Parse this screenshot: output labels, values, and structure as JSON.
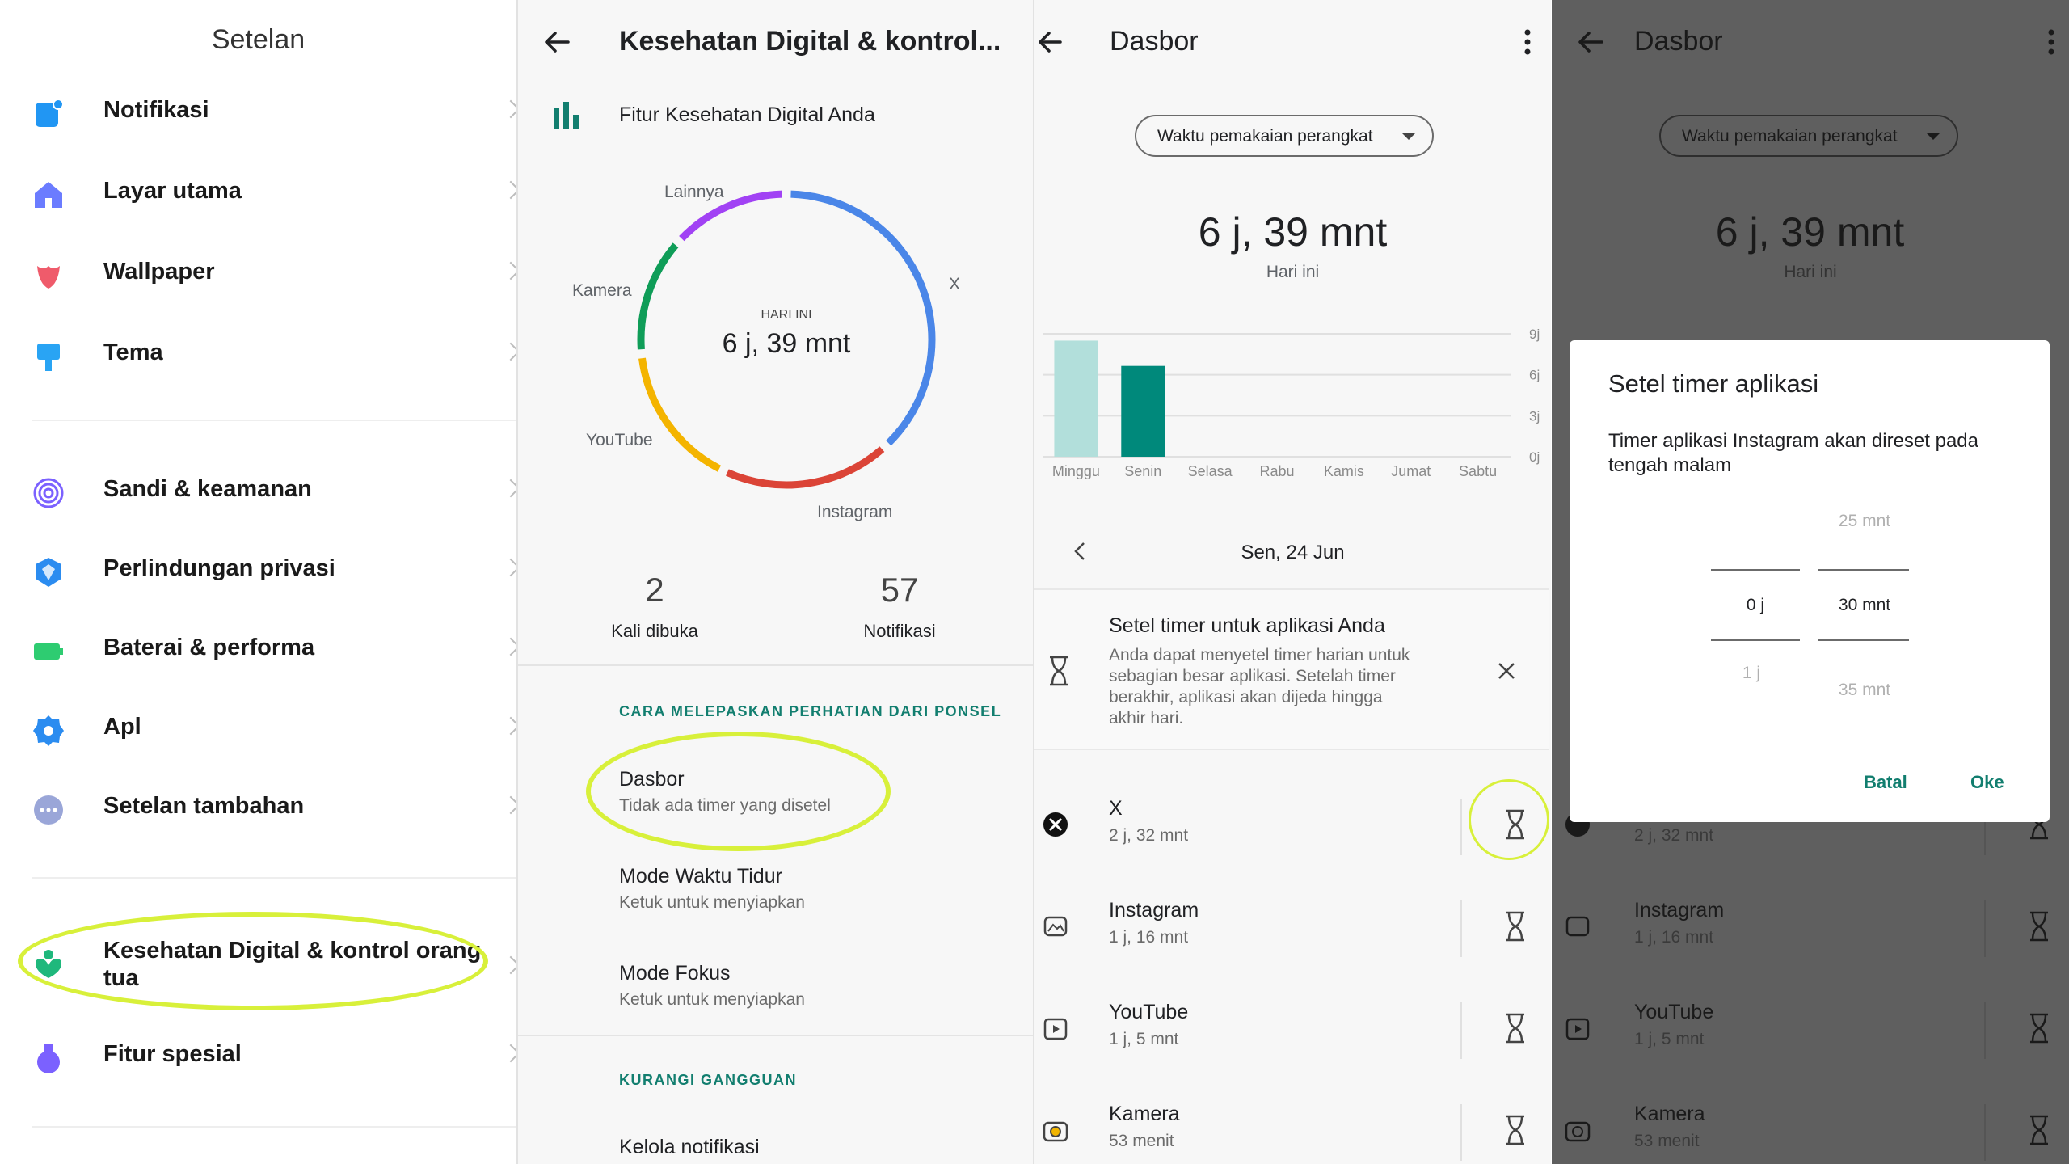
{
  "settings": {
    "title": "Setelan",
    "items": [
      {
        "label": "Notifikasi",
        "icon": "notification-icon",
        "color": "#2196f3"
      },
      {
        "label": "Layar utama",
        "icon": "home-icon",
        "color": "#6b7cff"
      },
      {
        "label": "Wallpaper",
        "icon": "tulip-icon",
        "color": "#ef5b6b"
      },
      {
        "label": "Tema",
        "icon": "brush-icon",
        "color": "#29a4f4"
      },
      {
        "label": "Sandi & keamanan",
        "icon": "fingerprint-icon",
        "color": "#7b61ff"
      },
      {
        "label": "Perlindungan privasi",
        "icon": "shield-icon",
        "color": "#2b8cf0"
      },
      {
        "label": "Baterai & performa",
        "icon": "battery-icon",
        "color": "#2ecc71"
      },
      {
        "label": "Apl",
        "icon": "gear-icon",
        "color": "#2b8cf0"
      },
      {
        "label": "Setelan tambahan",
        "icon": "more-icon",
        "color": "#9aa6d8"
      },
      {
        "label": "Kesehatan Digital & kontrol orang tua",
        "line1": "Kesehatan Digital & kontrol orang",
        "line2": "tua",
        "icon": "wellbeing-icon",
        "color": "#1fb87c"
      },
      {
        "label": "Fitur spesial",
        "icon": "flask-icon",
        "color": "#7b61ff"
      }
    ]
  },
  "wellbeing": {
    "title": "Kesehatan Digital & kontrol...",
    "feature_label": "Fitur Kesehatan Digital Anda",
    "donut": {
      "center_caption": "HARI INI",
      "center_value": "6 j, 39 mnt",
      "segments": [
        {
          "label": "X",
          "minutes": 152,
          "color": "#4a86e8"
        },
        {
          "label": "Instagram",
          "minutes": 76,
          "color": "#db4437"
        },
        {
          "label": "YouTube",
          "minutes": 65,
          "color": "#f4b400"
        },
        {
          "label": "Kamera",
          "minutes": 53,
          "color": "#0f9d58"
        },
        {
          "label": "Lainnya",
          "minutes": 53,
          "color": "#a142f4"
        }
      ]
    },
    "stats": [
      {
        "value": "2",
        "label": "Kali dibuka"
      },
      {
        "value": "57",
        "label": "Notifikasi"
      }
    ],
    "section1": "CARA MELEPASKAN PERHATIAN DARI PONSEL",
    "rows": [
      {
        "title": "Dasbor",
        "sub": "Tidak ada timer yang disetel"
      },
      {
        "title": "Mode Waktu Tidur",
        "sub": "Ketuk untuk menyiapkan"
      },
      {
        "title": "Mode Fokus",
        "sub": "Ketuk untuk menyiapkan"
      }
    ],
    "section2": "KURANGI GANGGUAN",
    "last_row": "Kelola notifikasi"
  },
  "dashboard": {
    "title": "Dasbor",
    "dropdown": "Waktu pemakaian perangkat",
    "total": "6 j, 39 mnt",
    "total_caption": "Hari ini",
    "date_label": "Sen, 24 Jun",
    "timer_card": {
      "title": "Setel timer untuk aplikasi Anda",
      "body_lines": [
        "Anda dapat menyetel timer harian untuk",
        "sebagian besar aplikasi. Setelah timer",
        "berakhir, aplikasi akan dijeda hingga",
        "akhir hari."
      ]
    },
    "apps": [
      {
        "name": "X",
        "time": "2 j, 32 mnt",
        "icon": "x-logo-icon"
      },
      {
        "name": "Instagram",
        "time": "1 j, 16 mnt",
        "icon": "instagram-icon"
      },
      {
        "name": "YouTube",
        "time": "1 j, 5 mnt",
        "icon": "youtube-icon"
      },
      {
        "name": "Kamera",
        "time": "53 menit",
        "icon": "camera-icon"
      }
    ]
  },
  "chart_data": {
    "type": "bar",
    "categories": [
      "Minggu",
      "Senin",
      "Selasa",
      "Rabu",
      "Kamis",
      "Jumat",
      "Sabtu"
    ],
    "values": [
      8.5,
      6.65,
      0,
      0,
      0,
      0,
      0
    ],
    "y_ticks": [
      "0j",
      "3j",
      "6j",
      "9j"
    ],
    "ylim": [
      0,
      9
    ],
    "colors": [
      "#b2dfdb",
      "#00897b"
    ]
  },
  "dialog": {
    "title": "Setel timer aplikasi",
    "body_line1": "Timer aplikasi Instagram akan direset pada",
    "body_line2": "tengah malam",
    "hours": {
      "above": "",
      "selected": "0 j",
      "below": "1 j"
    },
    "minutes": {
      "above": "25 mnt",
      "selected": "30 mnt",
      "below": "35 mnt"
    },
    "cancel": "Batal",
    "ok": "Oke"
  },
  "colors": {
    "accent": "#127e6f",
    "highlight": "#d8f03a"
  }
}
